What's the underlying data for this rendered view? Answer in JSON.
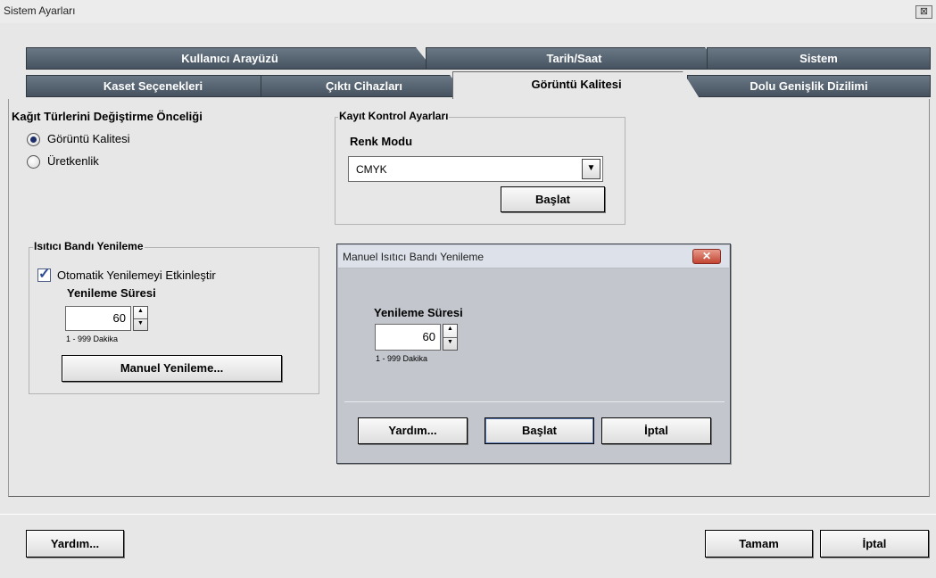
{
  "window": {
    "title": "Sistem Ayarları",
    "close_glyph": "⊠"
  },
  "tabs": {
    "row1": [
      "Kullanıcı Arayüzü",
      "Tarih/Saat",
      "Sistem"
    ],
    "row2": [
      "Kaset Seçenekleri",
      "Çıktı Cihazları",
      "Görüntü Kalitesi",
      "Dolu Genişlik Dizilimi"
    ],
    "active": "Görüntü Kalitesi"
  },
  "paper_priority": {
    "label": "Kağıt Türlerini Değiştirme Önceliği",
    "options": [
      "Görüntü Kalitesi",
      "Üretkenlik"
    ],
    "selected": "Görüntü Kalitesi"
  },
  "registration": {
    "legend": "Kayıt Kontrol Ayarları",
    "color_mode_label": "Renk Modu",
    "color_mode_value": "CMYK",
    "start_label": "Başlat"
  },
  "fuser": {
    "legend": "Isıtıcı Bandı Yenileme",
    "auto_label": "Otomatik Yenilemeyi Etkinleştir",
    "auto_checked": true,
    "duration_label": "Yenileme Süresi",
    "duration_value": "60",
    "range_text": "1 - 999 Dakika",
    "manual_button": "Manuel Yenileme..."
  },
  "dialog": {
    "title": "Manuel Isıtıcı Bandı Yenileme",
    "close_glyph": "✕",
    "duration_label": "Yenileme Süresi",
    "duration_value": "60",
    "range_text": "1 - 999 Dakika",
    "help_button": "Yardım...",
    "start_button": "Başlat",
    "cancel_button": "İptal"
  },
  "footer": {
    "help_button": "Yardım...",
    "ok_button": "Tamam",
    "cancel_button": "İptal"
  },
  "icons": {
    "dropdown": "▼",
    "spin_up": "▲",
    "spin_down": "▼",
    "check": "✓"
  }
}
